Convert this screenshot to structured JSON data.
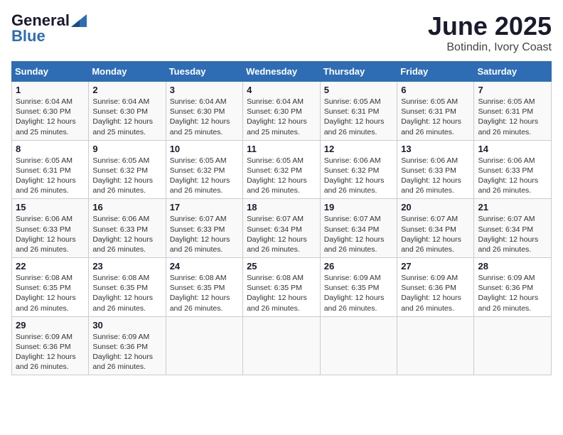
{
  "header": {
    "logo_general": "General",
    "logo_blue": "Blue",
    "title": "June 2025",
    "subtitle": "Botindin, Ivory Coast"
  },
  "calendar": {
    "days_of_week": [
      "Sunday",
      "Monday",
      "Tuesday",
      "Wednesday",
      "Thursday",
      "Friday",
      "Saturday"
    ],
    "weeks": [
      [
        {
          "day": "",
          "detail": ""
        },
        {
          "day": "2",
          "detail": "Sunrise: 6:04 AM\nSunset: 6:30 PM\nDaylight: 12 hours\nand 25 minutes."
        },
        {
          "day": "3",
          "detail": "Sunrise: 6:04 AM\nSunset: 6:30 PM\nDaylight: 12 hours\nand 25 minutes."
        },
        {
          "day": "4",
          "detail": "Sunrise: 6:04 AM\nSunset: 6:30 PM\nDaylight: 12 hours\nand 25 minutes."
        },
        {
          "day": "5",
          "detail": "Sunrise: 6:05 AM\nSunset: 6:31 PM\nDaylight: 12 hours\nand 26 minutes."
        },
        {
          "day": "6",
          "detail": "Sunrise: 6:05 AM\nSunset: 6:31 PM\nDaylight: 12 hours\nand 26 minutes."
        },
        {
          "day": "7",
          "detail": "Sunrise: 6:05 AM\nSunset: 6:31 PM\nDaylight: 12 hours\nand 26 minutes."
        }
      ],
      [
        {
          "day": "8",
          "detail": "Sunrise: 6:05 AM\nSunset: 6:31 PM\nDaylight: 12 hours\nand 26 minutes."
        },
        {
          "day": "9",
          "detail": "Sunrise: 6:05 AM\nSunset: 6:32 PM\nDaylight: 12 hours\nand 26 minutes."
        },
        {
          "day": "10",
          "detail": "Sunrise: 6:05 AM\nSunset: 6:32 PM\nDaylight: 12 hours\nand 26 minutes."
        },
        {
          "day": "11",
          "detail": "Sunrise: 6:05 AM\nSunset: 6:32 PM\nDaylight: 12 hours\nand 26 minutes."
        },
        {
          "day": "12",
          "detail": "Sunrise: 6:06 AM\nSunset: 6:32 PM\nDaylight: 12 hours\nand 26 minutes."
        },
        {
          "day": "13",
          "detail": "Sunrise: 6:06 AM\nSunset: 6:33 PM\nDaylight: 12 hours\nand 26 minutes."
        },
        {
          "day": "14",
          "detail": "Sunrise: 6:06 AM\nSunset: 6:33 PM\nDaylight: 12 hours\nand 26 minutes."
        }
      ],
      [
        {
          "day": "15",
          "detail": "Sunrise: 6:06 AM\nSunset: 6:33 PM\nDaylight: 12 hours\nand 26 minutes."
        },
        {
          "day": "16",
          "detail": "Sunrise: 6:06 AM\nSunset: 6:33 PM\nDaylight: 12 hours\nand 26 minutes."
        },
        {
          "day": "17",
          "detail": "Sunrise: 6:07 AM\nSunset: 6:33 PM\nDaylight: 12 hours\nand 26 minutes."
        },
        {
          "day": "18",
          "detail": "Sunrise: 6:07 AM\nSunset: 6:34 PM\nDaylight: 12 hours\nand 26 minutes."
        },
        {
          "day": "19",
          "detail": "Sunrise: 6:07 AM\nSunset: 6:34 PM\nDaylight: 12 hours\nand 26 minutes."
        },
        {
          "day": "20",
          "detail": "Sunrise: 6:07 AM\nSunset: 6:34 PM\nDaylight: 12 hours\nand 26 minutes."
        },
        {
          "day": "21",
          "detail": "Sunrise: 6:07 AM\nSunset: 6:34 PM\nDaylight: 12 hours\nand 26 minutes."
        }
      ],
      [
        {
          "day": "22",
          "detail": "Sunrise: 6:08 AM\nSunset: 6:35 PM\nDaylight: 12 hours\nand 26 minutes."
        },
        {
          "day": "23",
          "detail": "Sunrise: 6:08 AM\nSunset: 6:35 PM\nDaylight: 12 hours\nand 26 minutes."
        },
        {
          "day": "24",
          "detail": "Sunrise: 6:08 AM\nSunset: 6:35 PM\nDaylight: 12 hours\nand 26 minutes."
        },
        {
          "day": "25",
          "detail": "Sunrise: 6:08 AM\nSunset: 6:35 PM\nDaylight: 12 hours\nand 26 minutes."
        },
        {
          "day": "26",
          "detail": "Sunrise: 6:09 AM\nSunset: 6:35 PM\nDaylight: 12 hours\nand 26 minutes."
        },
        {
          "day": "27",
          "detail": "Sunrise: 6:09 AM\nSunset: 6:36 PM\nDaylight: 12 hours\nand 26 minutes."
        },
        {
          "day": "28",
          "detail": "Sunrise: 6:09 AM\nSunset: 6:36 PM\nDaylight: 12 hours\nand 26 minutes."
        }
      ],
      [
        {
          "day": "29",
          "detail": "Sunrise: 6:09 AM\nSunset: 6:36 PM\nDaylight: 12 hours\nand 26 minutes."
        },
        {
          "day": "30",
          "detail": "Sunrise: 6:09 AM\nSunset: 6:36 PM\nDaylight: 12 hours\nand 26 minutes."
        },
        {
          "day": "",
          "detail": ""
        },
        {
          "day": "",
          "detail": ""
        },
        {
          "day": "",
          "detail": ""
        },
        {
          "day": "",
          "detail": ""
        },
        {
          "day": "",
          "detail": ""
        }
      ]
    ],
    "week0_sun": {
      "day": "1",
      "detail": "Sunrise: 6:04 AM\nSunset: 6:30 PM\nDaylight: 12 hours\nand 25 minutes."
    }
  }
}
